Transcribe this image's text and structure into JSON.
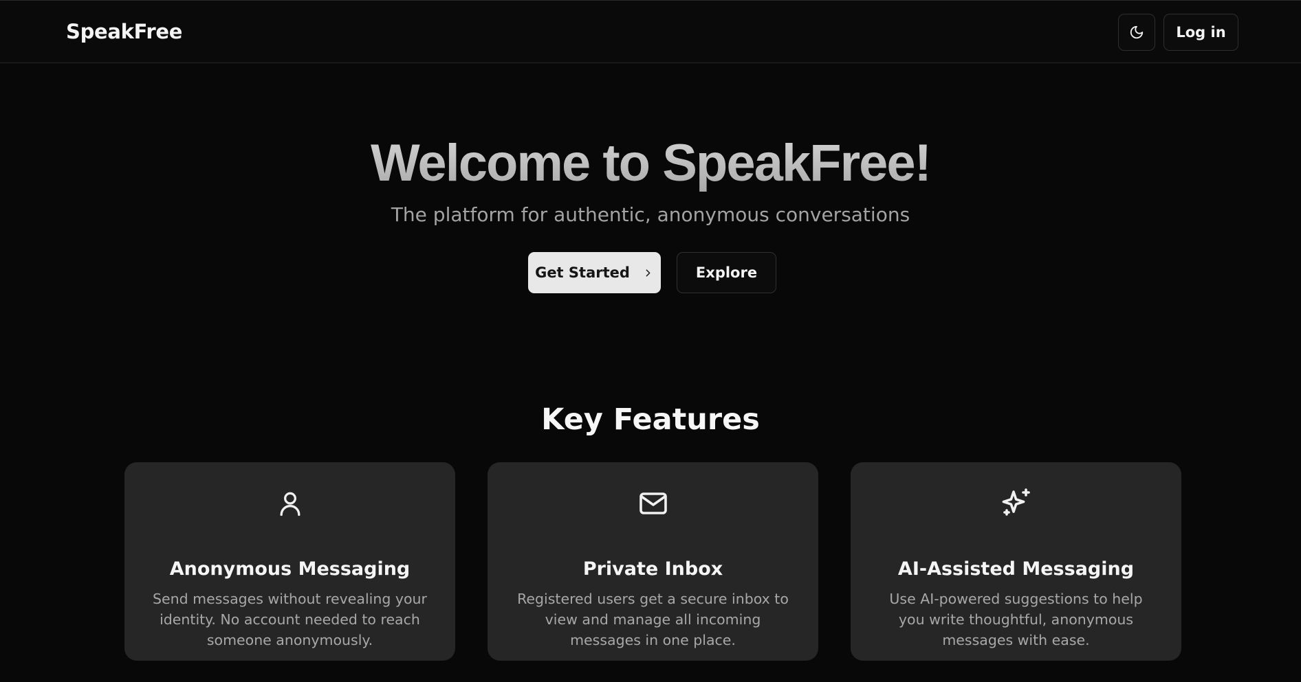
{
  "header": {
    "brand": "SpeakFree",
    "theme_toggle_icon": "moon-icon",
    "login_label": "Log in"
  },
  "hero": {
    "title": "Welcome to SpeakFree!",
    "subtitle": "The platform for authentic, anonymous conversations",
    "primary_cta": "Get Started",
    "primary_cta_icon": "chevron-right-icon",
    "secondary_cta": "Explore"
  },
  "features": {
    "title": "Key Features",
    "items": [
      {
        "icon": "user-icon",
        "title": "Anonymous Messaging",
        "description": "Send messages without revealing your identity. No account needed to reach someone anonymously."
      },
      {
        "icon": "mail-icon",
        "title": "Private Inbox",
        "description": "Registered users get a secure inbox to view and manage all incoming messages in one place."
      },
      {
        "icon": "sparkles-icon",
        "title": "AI-Assisted Messaging",
        "description": "Use AI-powered suggestions to help you write thoughtful, anonymous messages with ease."
      }
    ]
  },
  "colors": {
    "background": "#080808",
    "card_background": "#262626",
    "primary_button": "#e8e8e8",
    "muted_text": "#a3a3a3"
  }
}
